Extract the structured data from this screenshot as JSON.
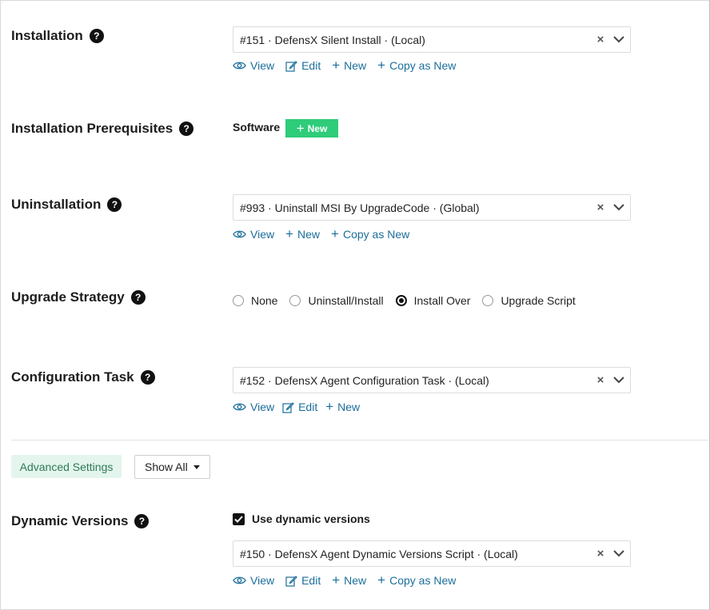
{
  "sections": {
    "installation": {
      "label": "Installation",
      "help": "?",
      "selected": "#151 · DefensX Silent Install · (Local)",
      "actions": {
        "view": "View",
        "edit": "Edit",
        "new": "New",
        "copy": "Copy as New"
      }
    },
    "prerequisites": {
      "label": "Installation Prerequisites",
      "help": "?",
      "software_label": "Software",
      "new_button": "New"
    },
    "uninstallation": {
      "label": "Uninstallation",
      "help": "?",
      "selected": "#993 · Uninstall MSI By UpgradeCode · (Global)",
      "actions": {
        "view": "View",
        "new": "New",
        "copy": "Copy as New"
      }
    },
    "upgrade_strategy": {
      "label": "Upgrade Strategy",
      "help": "?",
      "options": [
        {
          "label": "None",
          "selected": false
        },
        {
          "label": "Uninstall/Install",
          "selected": false
        },
        {
          "label": "Install Over",
          "selected": true
        },
        {
          "label": "Upgrade Script",
          "selected": false
        }
      ]
    },
    "configuration_task": {
      "label": "Configuration Task",
      "help": "?",
      "selected": "#152 · DefensX Agent Configuration Task · (Local)",
      "actions": {
        "view": "View",
        "edit": "Edit",
        "new": "New"
      }
    },
    "advanced": {
      "tab_label": "Advanced Settings",
      "filter_value": "Show All"
    },
    "dynamic_versions": {
      "label": "Dynamic Versions",
      "help": "?",
      "checkbox_label": "Use dynamic versions",
      "checked": true,
      "selected": "#150 · DefensX Agent Dynamic Versions Script · (Local)",
      "actions": {
        "view": "View",
        "edit": "Edit",
        "new": "New",
        "copy": "Copy as New"
      }
    }
  },
  "colors": {
    "link": "#1b6e9b",
    "new_button_bg": "#2fcc79",
    "advanced_tab_bg": "#e4f5ee",
    "advanced_tab_text": "#2f7a57"
  },
  "icons": {
    "clear": "×",
    "view": "eye-icon",
    "edit": "edit-icon",
    "new": "plus-icon",
    "dropdown": "chevron-down-icon"
  }
}
